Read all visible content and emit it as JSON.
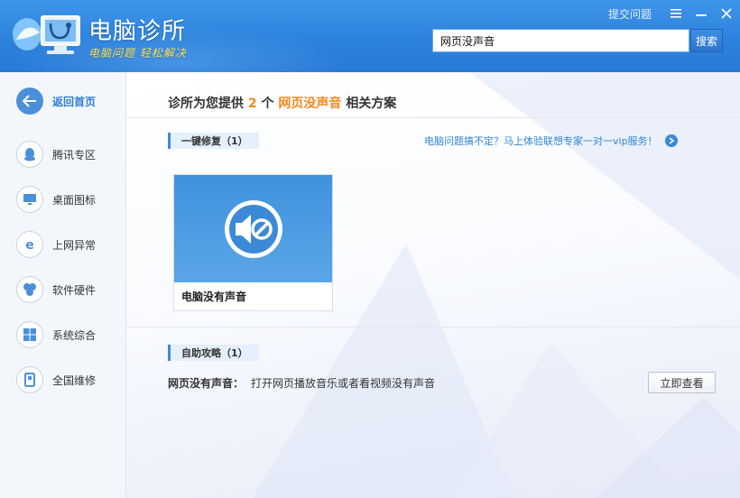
{
  "header": {
    "app_title": "电脑诊所",
    "slogan": "电脑问题 轻松解决",
    "feedback_label": "提交问题",
    "menu_icon": "menu-icon",
    "minimize_icon": "minimize-icon",
    "close_icon": "close-icon",
    "colors": {
      "bar": "#2d82dc",
      "slogan": "#ffe45a"
    }
  },
  "search": {
    "value": "网页没声音",
    "button_label": "搜索"
  },
  "sidebar": {
    "items": [
      {
        "label": "返回首页",
        "icon": "back-arrow-icon",
        "active": true
      },
      {
        "label": "腾讯专区",
        "icon": "qq-penguin-icon"
      },
      {
        "label": "桌面图标",
        "icon": "monitor-icon"
      },
      {
        "label": "上网异常",
        "icon": "ie-browser-icon"
      },
      {
        "label": "软件硬件",
        "icon": "hardware-icon"
      },
      {
        "label": "系统综合",
        "icon": "windows-icon"
      },
      {
        "label": "全国维修",
        "icon": "phone-icon"
      }
    ]
  },
  "main": {
    "result_prefix": "诊所为您提供",
    "result_count": "2",
    "result_unit": "个",
    "result_keyword": "网页没声音",
    "result_suffix": "相关方案",
    "quick_fix": {
      "label": "一键修复（1）",
      "vip_text": "电脑问题搞不定？马上体验联想专家一对一vip服务！",
      "cards": [
        {
          "label": "电脑没有声音",
          "icon": "speaker-muted-icon"
        }
      ]
    },
    "self_help": {
      "label": "自助攻略（1）",
      "items": [
        {
          "key": "网页没有声音：",
          "desc": "打开网页播放音乐或者看视频没有声音",
          "button": "立即查看"
        }
      ]
    }
  }
}
